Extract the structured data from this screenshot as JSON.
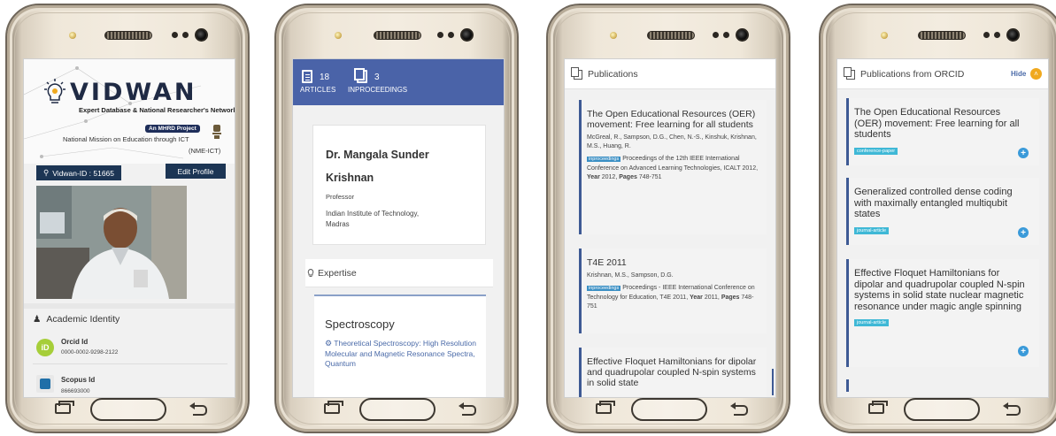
{
  "screen1": {
    "logo_text": "VIDWAN",
    "logo_subtitle": "Expert Database & National Researcher's Network",
    "mhrd_badge": "An MHRD Project",
    "mission_text": "National Mission on Education through ICT",
    "mission_short": "(NME-ICT)",
    "vidwan_id": "Vidwan-ID : 51665",
    "edit_profile": "Edit Profile",
    "academic_identity": "Academic Identity",
    "orcid_label": "Orcid Id",
    "orcid_value": "0000-0002-9298-2122",
    "scopus_label": "Scopus Id",
    "scopus_value": "866693000"
  },
  "screen2": {
    "articles_count": "18",
    "articles_label": "ARTICLES",
    "inproceedings_count": "3",
    "inproceedings_label": "INPROCEEDINGS",
    "name": "Dr. Mangala Sunder Krishnan",
    "role": "Professor",
    "institution": "Indian Institute of Technology, Madras",
    "expertise_label": "Expertise",
    "expertise_title": "Spectroscopy",
    "expertise_link": "Theoretical Spectroscopy: High Resolution Molecular and Magnetic Resonance Spectra, Quantum"
  },
  "screen3": {
    "header": "Publications",
    "publications": [
      {
        "title": "The Open Educational Resources (OER) movement: Free learning for all students",
        "authors": "McGreal, R., Sampson, D.G., Chen, N.-S., Kinshuk, Krishnan, M.S., Huang, R.",
        "badge": "inproceedings",
        "venue": "Proceedings of the 12th IEEE International Conference on Advanced Learning Technologies, ICALT 2012,",
        "year_label": "Year",
        "year": "2012,",
        "pages_label": "Pages",
        "pages": "748-751"
      },
      {
        "title": "T4E 2011",
        "authors": "Krishnan, M.S., Sampson, D.G.",
        "badge": "inproceedings",
        "venue": "Proceedings - IEEE International Conference on Technology for Education, T4E 2011,",
        "year_label": "Year",
        "year": "2011,",
        "pages_label": "Pages",
        "pages": "748-751"
      },
      {
        "title": "Effective Floquet Hamiltonians for dipolar and quadrupolar coupled N-spin systems in solid state"
      }
    ]
  },
  "screen4": {
    "header": "Publications from ORCID",
    "hide_label": "Hide",
    "items": [
      {
        "title": "The Open Educational Resources (OER) movement: Free learning for all students",
        "type": "conference-paper"
      },
      {
        "title": "Generalized controlled dense coding with maximally entangled multiqubit states",
        "type": "journal-article"
      },
      {
        "title": "Effective Floquet Hamiltonians for dipolar and quadrupolar coupled N-spin systems in solid state nuclear magnetic resonance under magic angle spinning",
        "type": "journal-article"
      }
    ]
  },
  "colors": {
    "brand_navy": "#1c3554",
    "stats_blue": "#4a63a8",
    "link_blue": "#4a6aa8",
    "orcid_green": "#a6ce39",
    "toggle_orange": "#f0a91e",
    "badge_cyan": "#3fb8d6"
  }
}
